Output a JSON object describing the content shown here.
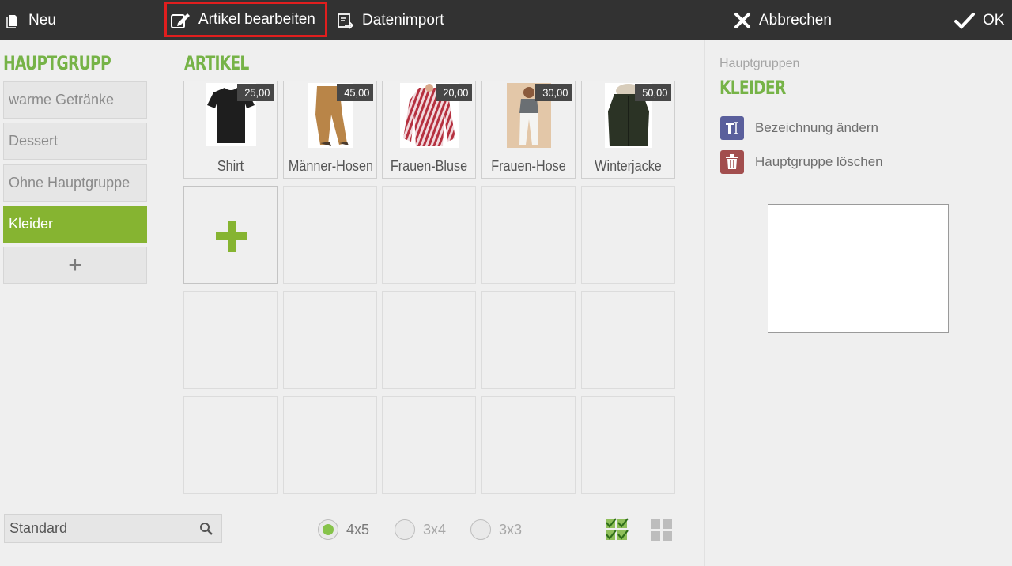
{
  "toolbar": {
    "new_label": "Neu",
    "edit_label": "Artikel bearbeiten",
    "import_label": "Datenimport",
    "cancel_label": "Abbrechen",
    "ok_label": "OK"
  },
  "groups_heading": "HAUPTGRUPP",
  "articles_heading": "ARTIKEL",
  "groups": [
    {
      "label": "warme Getränke",
      "active": false
    },
    {
      "label": "Dessert",
      "active": false
    },
    {
      "label": "Ohne Hauptgruppe",
      "active": false
    },
    {
      "label": "Kleider",
      "active": true
    }
  ],
  "groups_add_label": "+",
  "articles": [
    {
      "name": "Shirt",
      "price": "25,00",
      "image": "tshirt"
    },
    {
      "name": "Männer-Hosen",
      "price": "45,00",
      "image": "pants"
    },
    {
      "name": "Frauen-Bluse",
      "price": "20,00",
      "image": "blouse"
    },
    {
      "name": "Frauen-Hose",
      "price": "30,00",
      "image": "woman-pants"
    },
    {
      "name": "Winterjacke",
      "price": "50,00",
      "image": "jacket"
    }
  ],
  "search": {
    "value": "Standard",
    "icon": "search-icon"
  },
  "grid_size": {
    "options": [
      "4x5",
      "3x4",
      "3x3"
    ],
    "selected": "4x5"
  },
  "view_icons": [
    "multi-select-check-icon",
    "grid-view-icon"
  ],
  "right_panel": {
    "label": "Hauptgruppen",
    "title": "KLEIDER",
    "rename_label": "Bezeichnung ändern",
    "delete_label": "Hauptgruppe löschen"
  },
  "colors": {
    "accent_green": "#86b431",
    "heading_green": "#76b347",
    "topbar": "#323232",
    "highlight_red": "#e01e1e",
    "rename_icon_bg": "#5a5f9c",
    "delete_icon_bg": "#a24e4e"
  }
}
